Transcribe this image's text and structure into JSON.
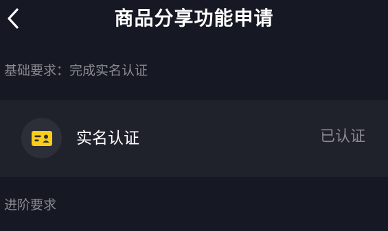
{
  "header": {
    "back_icon": "chevron-left-icon",
    "title": "商品分享功能申请"
  },
  "basic_requirement": {
    "label": "基础要求：完成实名认证"
  },
  "verification_item": {
    "icon": "id-card-icon",
    "icon_color": "#FACE15",
    "label": "实名认证",
    "status": "已认证"
  },
  "advanced_requirement": {
    "label": "进阶要求"
  }
}
